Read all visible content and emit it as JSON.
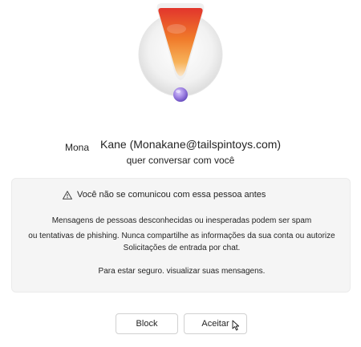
{
  "sender": {
    "first_name": "Mona",
    "rest": "Kane (Monakane@tailspintoys.com)"
  },
  "subtitle": "quer conversar com você",
  "warning": {
    "title": "Você não se comunicou com essa pessoa antes",
    "line1": "Mensagens de pessoas desconhecidas ou inesperadas podem ser spam",
    "line2": "ou tentativas de phishing. Nunca compartilhe as informações da sua conta ou autorize",
    "line3": "Solicitações de entrada por chat.",
    "line4": "Para estar seguro. visualizar suas mensagens."
  },
  "actions": {
    "block_label": "Block",
    "accept_label": "Aceitar"
  },
  "colors": {
    "accent_orange": "#f07a2a",
    "accent_red": "#e2352c",
    "dot_purple": "#9b7ee0",
    "box_bg": "#f5f5f5"
  },
  "icons": {
    "hero": "exclamation-illustration",
    "warning": "warning-triangle-icon",
    "cursor": "mouse-pointer-icon"
  }
}
